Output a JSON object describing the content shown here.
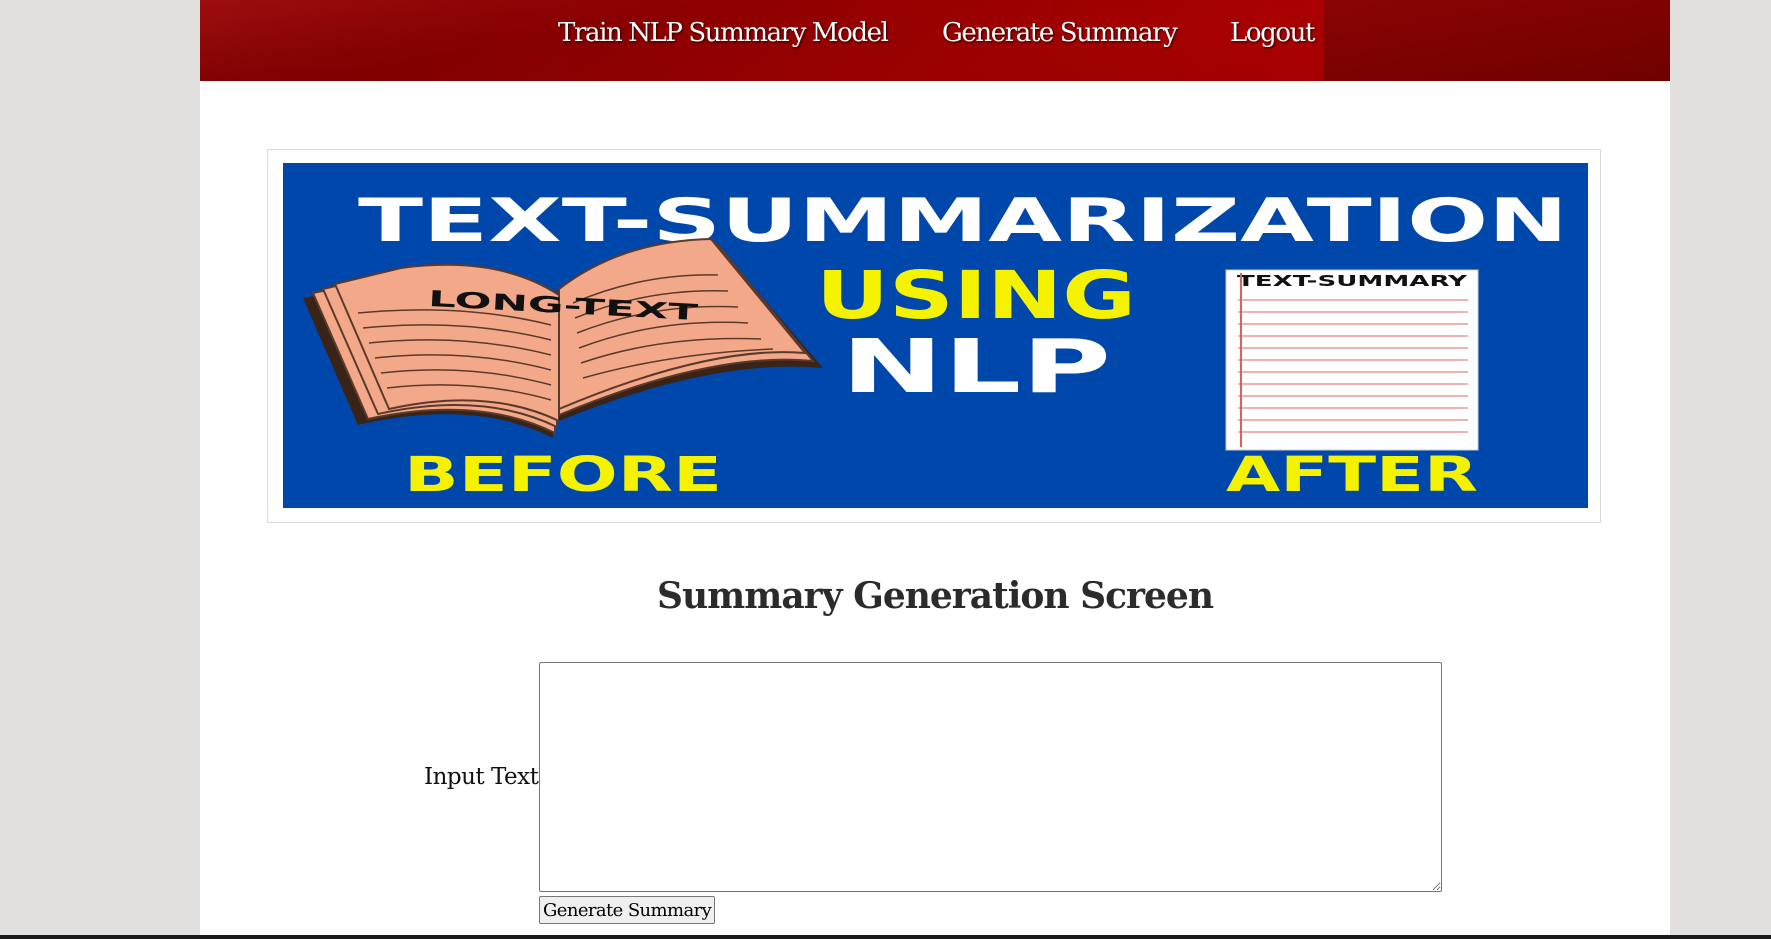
{
  "nav": {
    "items": [
      {
        "label": "Train NLP Summary Model"
      },
      {
        "label": "Generate Summary"
      },
      {
        "label": "Logout"
      }
    ]
  },
  "banner": {
    "title": "TEXT-SUMMARIZATION",
    "using": "USING",
    "nlp": "NLP",
    "book_label": "LONG-TEXT",
    "paper_label": "TEXT-SUMMARY",
    "before": "BEFORE",
    "after": "AFTER",
    "colors": {
      "background": "#0047ab",
      "accent_yellow": "#f5f200",
      "book": "#f4a88a"
    }
  },
  "main": {
    "title": "Summary Generation Screen",
    "input_label": "Input Text",
    "input_value": "",
    "button_label": "Generate Summary"
  },
  "colors": {
    "nav_background": "#8a0000",
    "page_background": "#ffffff",
    "outer_background": "#e2dfdf"
  }
}
